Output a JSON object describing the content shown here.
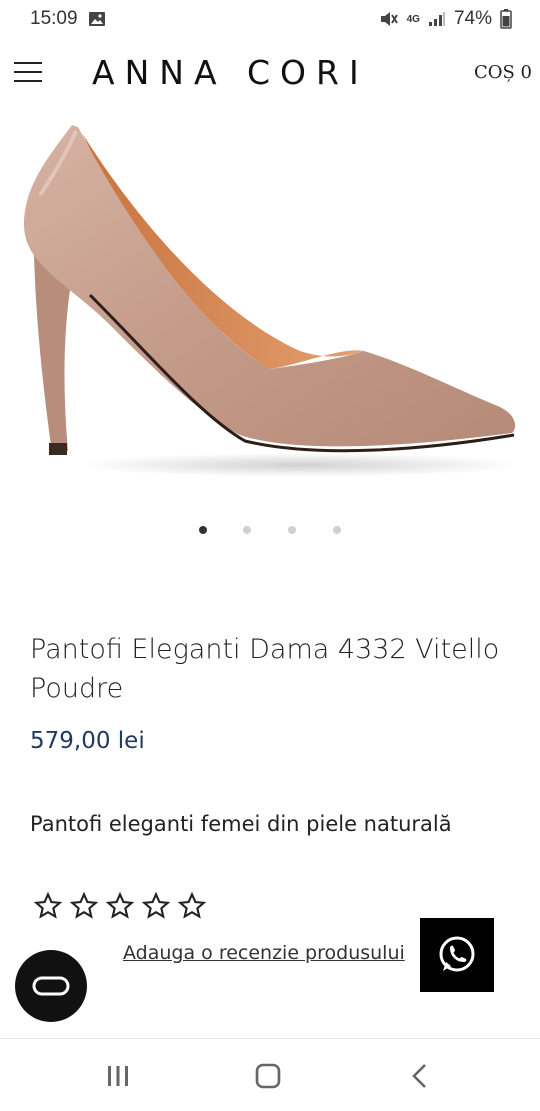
{
  "status_bar": {
    "time": "15:09",
    "network": "4G",
    "battery": "74%",
    "icons": [
      "image-notification-icon",
      "mute-icon",
      "signal-icon",
      "battery-icon"
    ]
  },
  "header": {
    "brand": "ANNA CORI",
    "cart_label": "COȘ 0",
    "menu_icon": "hamburger-menu-icon"
  },
  "gallery": {
    "image_alt": "nude pointed-toe stiletto pump",
    "slide_count": 4,
    "active_index": 0
  },
  "product": {
    "title": "Pantofi Eleganti Dama 4332 Vitello Poudre",
    "price": "579,00 lei",
    "description": "Pantofi eleganti femei din piele naturală",
    "rating": 0,
    "max_rating": 5,
    "review_link": "Adauga o recenzie produsului"
  },
  "floating": {
    "whatsapp_icon": "whatsapp-icon",
    "chat_icon": "chat-icon"
  },
  "colors": {
    "price": "#1f3a5a",
    "shoe": "#c9a393",
    "shoe_lining": "#d88a5c",
    "background": "#ffffff"
  },
  "nav_bar": {
    "icons": [
      "recent-apps-icon",
      "home-icon",
      "back-icon"
    ]
  }
}
